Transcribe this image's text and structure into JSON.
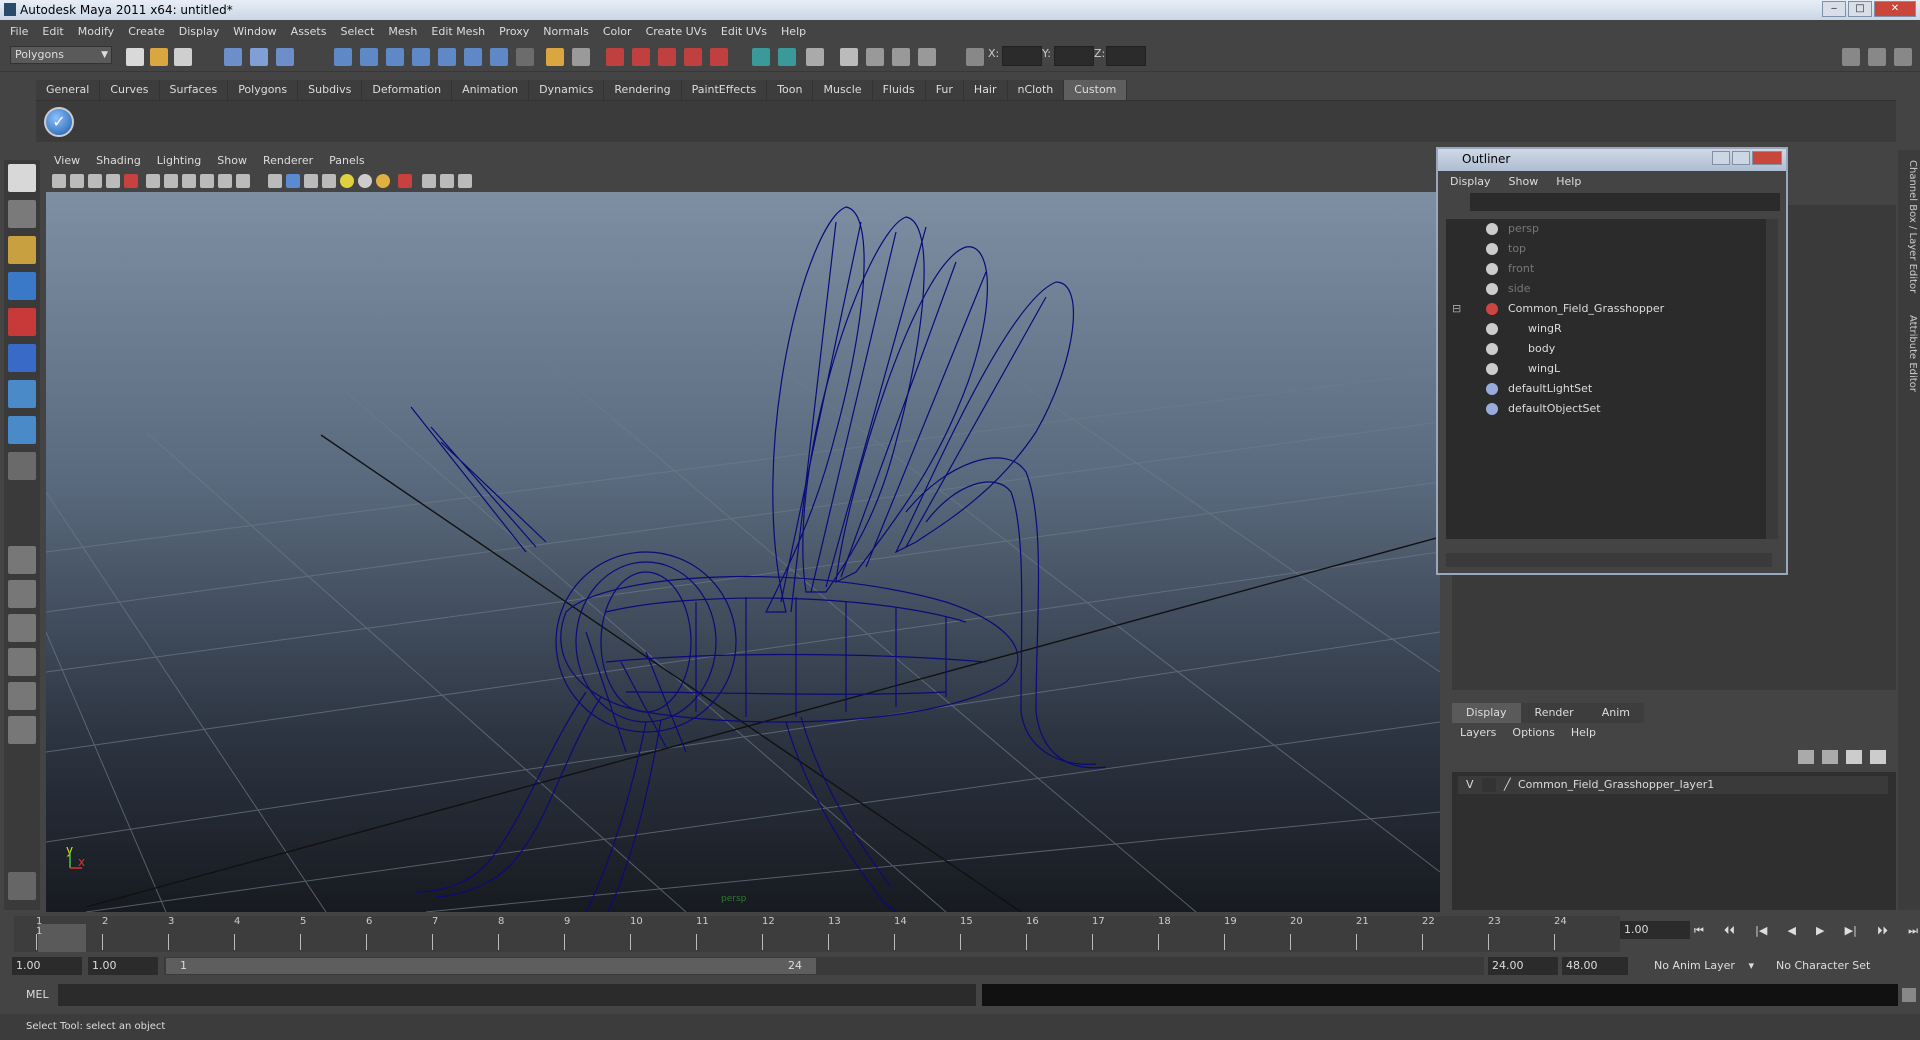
{
  "window": {
    "title": "Autodesk Maya 2011 x64: untitled*",
    "min": "‒",
    "max": "□",
    "close": "✕"
  },
  "menubar": [
    "File",
    "Edit",
    "Modify",
    "Create",
    "Display",
    "Window",
    "Assets",
    "Select",
    "Mesh",
    "Edit Mesh",
    "Proxy",
    "Normals",
    "Color",
    "Create UVs",
    "Edit UVs",
    "Help"
  ],
  "statusline": {
    "mode": "Polygons",
    "x_label": "X:",
    "y_label": "Y:",
    "z_label": "Z:"
  },
  "shelf_tabs": [
    "General",
    "Curves",
    "Surfaces",
    "Polygons",
    "Subdivs",
    "Deformation",
    "Animation",
    "Dynamics",
    "Rendering",
    "PaintEffects",
    "Toon",
    "Muscle",
    "Fluids",
    "Fur",
    "Hair",
    "nCloth",
    "Custom"
  ],
  "shelf_active": "Custom",
  "viewport_menu": [
    "View",
    "Shading",
    "Lighting",
    "Show",
    "Renderer",
    "Panels"
  ],
  "viewport": {
    "camera_label": "persp",
    "axis_y": "y",
    "axis_x": "x"
  },
  "outliner": {
    "title": "Outliner",
    "menu": [
      "Display",
      "Show",
      "Help"
    ],
    "items": [
      {
        "label": "persp",
        "dim": true,
        "indent": 0
      },
      {
        "label": "top",
        "dim": true,
        "indent": 0
      },
      {
        "label": "front",
        "dim": true,
        "indent": 0
      },
      {
        "label": "side",
        "dim": true,
        "indent": 0
      },
      {
        "label": "Common_Field_Grasshopper",
        "dim": false,
        "indent": 0
      },
      {
        "label": "wingR",
        "dim": false,
        "indent": 1
      },
      {
        "label": "body",
        "dim": false,
        "indent": 1
      },
      {
        "label": "wingL",
        "dim": false,
        "indent": 1
      },
      {
        "label": "defaultLightSet",
        "dim": false,
        "indent": 0
      },
      {
        "label": "defaultObjectSet",
        "dim": false,
        "indent": 0
      }
    ]
  },
  "side_tabs": [
    "Channel Box / Layer Editor",
    "Attribute Editor"
  ],
  "layer_editor": {
    "tabs": [
      "Display",
      "Render",
      "Anim"
    ],
    "active_tab": "Display",
    "menu": [
      "Layers",
      "Options",
      "Help"
    ],
    "layer": {
      "visible": "V",
      "name": "Common_Field_Grasshopper_layer1"
    }
  },
  "timeline": {
    "ticks": [
      "1",
      "2",
      "3",
      "4",
      "5",
      "6",
      "7",
      "8",
      "9",
      "10",
      "11",
      "12",
      "13",
      "14",
      "15",
      "16",
      "17",
      "18",
      "19",
      "20",
      "21",
      "22",
      "23",
      "24"
    ],
    "current_frame": "1",
    "frame_field": "1.00"
  },
  "playback": [
    "⏮",
    "⏴⏴",
    "|◀",
    "◀",
    "▶",
    "▶|",
    "⏵⏵",
    "⏭"
  ],
  "range": {
    "start": "1.00",
    "start2": "1.00",
    "slider_start": "1",
    "slider_end": "24",
    "end": "24.00",
    "end2": "48.00",
    "anim_layer": "No Anim Layer",
    "char_set": "No Character Set"
  },
  "command_line": {
    "label": "MEL"
  },
  "help_line": "Select Tool: select an object",
  "colors": {
    "wireframe": "#0b0a7a",
    "accent": "#5e5e5e"
  }
}
